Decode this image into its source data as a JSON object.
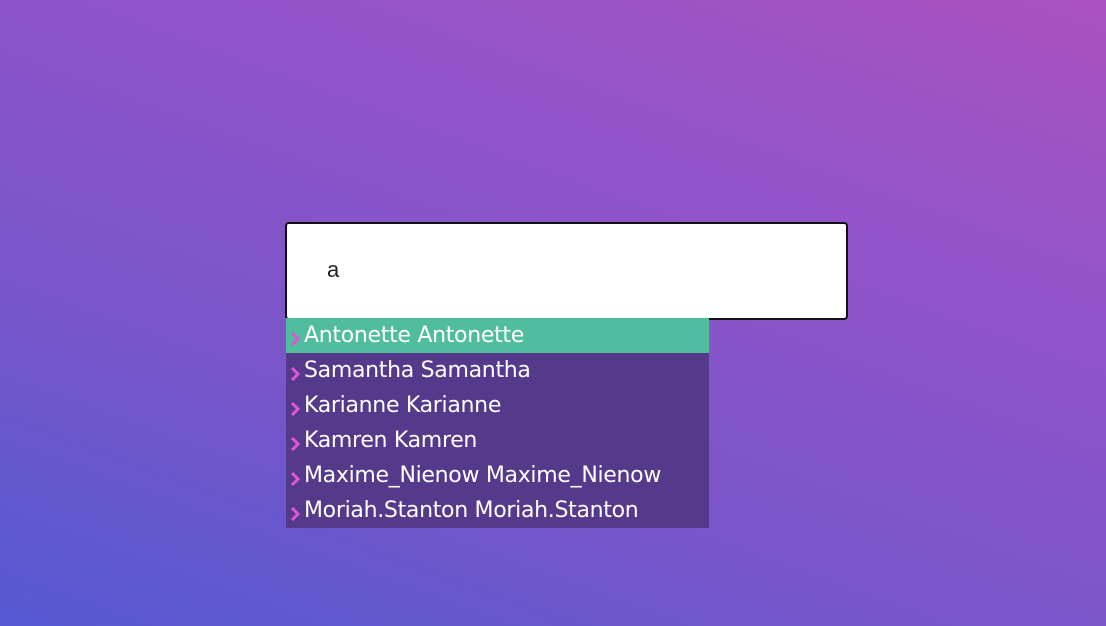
{
  "search": {
    "value": "a",
    "placeholder": ""
  },
  "dropdown": {
    "options": [
      {
        "label": "Antonette Antonette",
        "active": true
      },
      {
        "label": "Samantha Samantha",
        "active": false
      },
      {
        "label": "Karianne Karianne",
        "active": false
      },
      {
        "label": "Kamren Kamren",
        "active": false
      },
      {
        "label": "Maxime_Nienow Maxime_Nienow",
        "active": false
      },
      {
        "label": "Moriah.Stanton Moriah.Stanton",
        "active": false
      }
    ]
  },
  "colors": {
    "background_gradient_start": "#5559d2",
    "background_gradient_end": "#ab52c1",
    "dropdown_background": "#553a8c",
    "active_option": "#50bd9e",
    "chevron": "#e055d6",
    "text": "#ffffff"
  },
  "icons": {
    "option_marker": "chevron-right-icon"
  }
}
